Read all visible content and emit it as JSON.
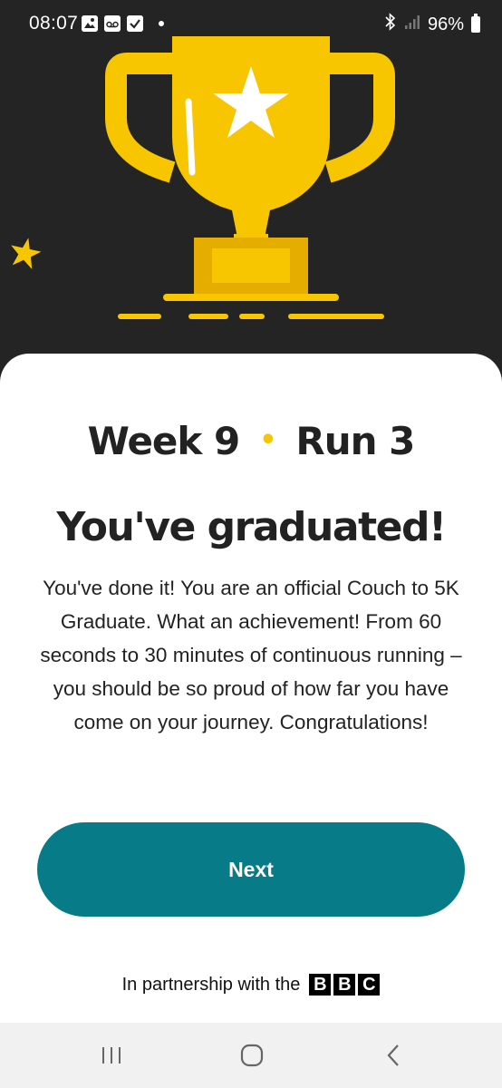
{
  "status_bar": {
    "time": "08:07",
    "battery": "96%",
    "left_icons": [
      "gallery-icon",
      "voicemail-icon",
      "checkbox-icon",
      "dot-icon"
    ],
    "right_icons": [
      "bluetooth-icon",
      "signal-icon",
      "battery-icon"
    ]
  },
  "hero": {
    "trophy_color": "#f7c600",
    "trophy_shade": "#e5ad00",
    "background": "#242424"
  },
  "header": {
    "week": "Week 9",
    "separator": "•",
    "run": "Run 3"
  },
  "main": {
    "title": "You've graduated!",
    "body": "You've done it! You are an official Couch to 5K Graduate. What an achievement! From 60 seconds to 30 minutes of continuous running – you should be so proud of how far you have come on your journey. Congratulations!"
  },
  "actions": {
    "next_label": "Next",
    "next_color": "#077b87"
  },
  "footer": {
    "partnership_text": "In partnership with the",
    "bbc_letters": [
      "B",
      "B",
      "C"
    ]
  },
  "navbar": {
    "buttons": [
      "recent-apps-icon",
      "home-icon",
      "back-icon"
    ]
  }
}
